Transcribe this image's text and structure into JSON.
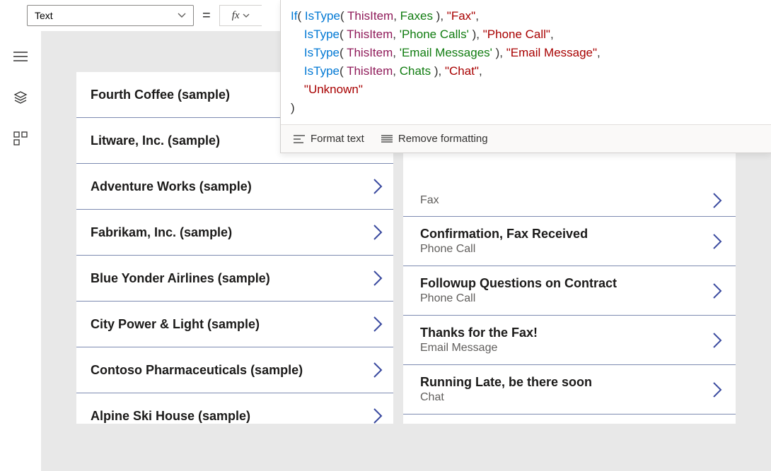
{
  "propertySelector": {
    "value": "Text"
  },
  "equals": "=",
  "fx": "fx",
  "formula": {
    "lines": [
      [
        {
          "t": "fn",
          "v": "If"
        },
        {
          "t": "punc",
          "v": "( "
        },
        {
          "t": "fn",
          "v": "IsType"
        },
        {
          "t": "punc",
          "v": "( "
        },
        {
          "t": "ident",
          "v": "ThisItem"
        },
        {
          "t": "punc",
          "v": ", "
        },
        {
          "t": "type",
          "v": "Faxes"
        },
        {
          "t": "punc",
          "v": " ), "
        },
        {
          "t": "str",
          "v": "\"Fax\""
        },
        {
          "t": "punc",
          "v": ","
        }
      ],
      [
        {
          "t": "pad",
          "v": "    "
        },
        {
          "t": "fn",
          "v": "IsType"
        },
        {
          "t": "punc",
          "v": "( "
        },
        {
          "t": "ident",
          "v": "ThisItem"
        },
        {
          "t": "punc",
          "v": ", "
        },
        {
          "t": "type",
          "v": "'Phone Calls'"
        },
        {
          "t": "punc",
          "v": " ), "
        },
        {
          "t": "str",
          "v": "\"Phone Call\""
        },
        {
          "t": "punc",
          "v": ","
        }
      ],
      [
        {
          "t": "pad",
          "v": "    "
        },
        {
          "t": "fn",
          "v": "IsType"
        },
        {
          "t": "punc",
          "v": "( "
        },
        {
          "t": "ident",
          "v": "ThisItem"
        },
        {
          "t": "punc",
          "v": ", "
        },
        {
          "t": "type",
          "v": "'Email Messages'"
        },
        {
          "t": "punc",
          "v": " ), "
        },
        {
          "t": "str",
          "v": "\"Email Message\""
        },
        {
          "t": "punc",
          "v": ","
        }
      ],
      [
        {
          "t": "pad",
          "v": "    "
        },
        {
          "t": "fn",
          "v": "IsType"
        },
        {
          "t": "punc",
          "v": "( "
        },
        {
          "t": "ident",
          "v": "ThisItem"
        },
        {
          "t": "punc",
          "v": ", "
        },
        {
          "t": "type",
          "v": "Chats"
        },
        {
          "t": "punc",
          "v": " ), "
        },
        {
          "t": "str",
          "v": "\"Chat\""
        },
        {
          "t": "punc",
          "v": ","
        }
      ],
      [
        {
          "t": "pad",
          "v": "    "
        },
        {
          "t": "str",
          "v": "\"Unknown\""
        }
      ],
      [
        {
          "t": "punc",
          "v": ")"
        }
      ]
    ]
  },
  "toolbar": {
    "format": "Format text",
    "remove": "Remove formatting"
  },
  "leftGallery": {
    "items": [
      {
        "title": "Fourth Coffee (sample)",
        "showChevron": false
      },
      {
        "title": "Litware, Inc. (sample)",
        "showChevron": false
      },
      {
        "title": "Adventure Works (sample)",
        "showChevron": true
      },
      {
        "title": "Fabrikam, Inc. (sample)",
        "showChevron": true
      },
      {
        "title": "Blue Yonder Airlines (sample)",
        "showChevron": true
      },
      {
        "title": "City Power & Light (sample)",
        "showChevron": true
      },
      {
        "title": "Contoso Pharmaceuticals (sample)",
        "showChevron": true
      },
      {
        "title": "Alpine Ski House (sample)",
        "showChevron": true
      }
    ]
  },
  "rightGallery": {
    "partialTop": {
      "kind": "Fax"
    },
    "items": [
      {
        "subject": "Confirmation, Fax Received",
        "kind": "Phone Call"
      },
      {
        "subject": "Followup Questions on Contract",
        "kind": "Phone Call"
      },
      {
        "subject": "Thanks for the Fax!",
        "kind": "Email Message"
      },
      {
        "subject": "Running Late, be there soon",
        "kind": "Chat"
      }
    ]
  }
}
